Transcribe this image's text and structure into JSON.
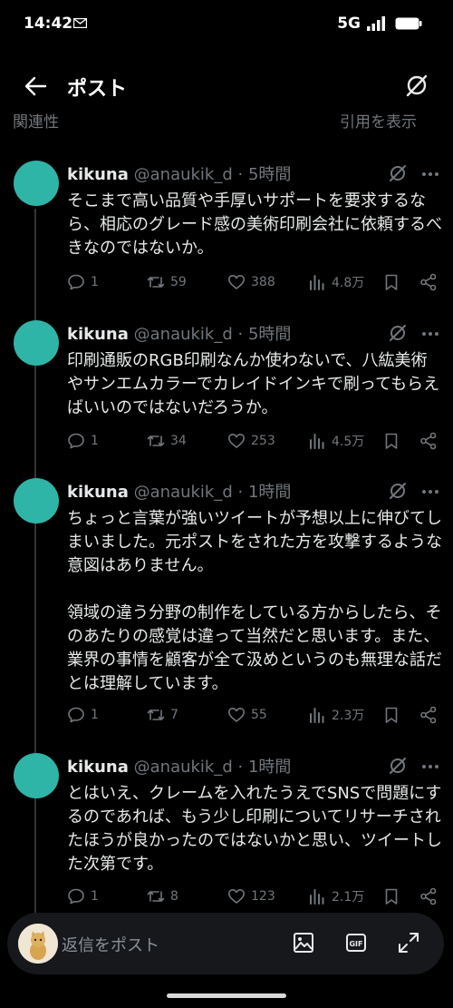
{
  "status": {
    "time": "14:42",
    "network": "5G"
  },
  "header": {
    "title": "ポスト"
  },
  "partial": {
    "left": "関連性",
    "right": "引用を表示"
  },
  "tweets": [
    {
      "name": "kikuna",
      "handle": "@anaukik_d",
      "time": "5時間",
      "text": "そこまで高い品質や手厚いサポートを要求するなら、相応のグレード感の美術印刷会社に依頼するべきなのではないか。",
      "replies": "1",
      "retweets": "59",
      "likes": "388",
      "views": "4.8万"
    },
    {
      "name": "kikuna",
      "handle": "@anaukik_d",
      "time": "5時間",
      "text": "印刷通販のRGB印刷なんか使わないで、八紘美術やサンエムカラーでカレイドインキで刷ってもらえばいいのではないだろうか。",
      "replies": "1",
      "retweets": "34",
      "likes": "253",
      "views": "4.5万"
    },
    {
      "name": "kikuna",
      "handle": "@anaukik_d",
      "time": "1時間",
      "text": "ちょっと言葉が強いツイートが予想以上に伸びてしまいました。元ポストをされた方を攻撃するような意図はありません。\n\n領域の違う分野の制作をしている方からしたら、そのあたりの感覚は違って当然だと思います。また、業界の事情を顧客が全て汲めというのも無理な話だとは理解しています。",
      "replies": "1",
      "retweets": "7",
      "likes": "55",
      "views": "2.3万"
    },
    {
      "name": "kikuna",
      "handle": "@anaukik_d",
      "time": "1時間",
      "text": "とはいえ、クレームを入れたうえでSNSで問題にするのであれば、もう少し印刷についてリサーチされたほうが良かったのではないかと思い、ツイートした次第です。",
      "replies": "1",
      "retweets": "8",
      "likes": "123",
      "views": "2.1万"
    }
  ],
  "compose": {
    "placeholder": "返信をポスト",
    "gif_label": "GIF"
  },
  "colors": {
    "avatar": "#2fb5a8",
    "muted": "#71767b",
    "text": "#e7e9ea",
    "background": "#000000"
  }
}
